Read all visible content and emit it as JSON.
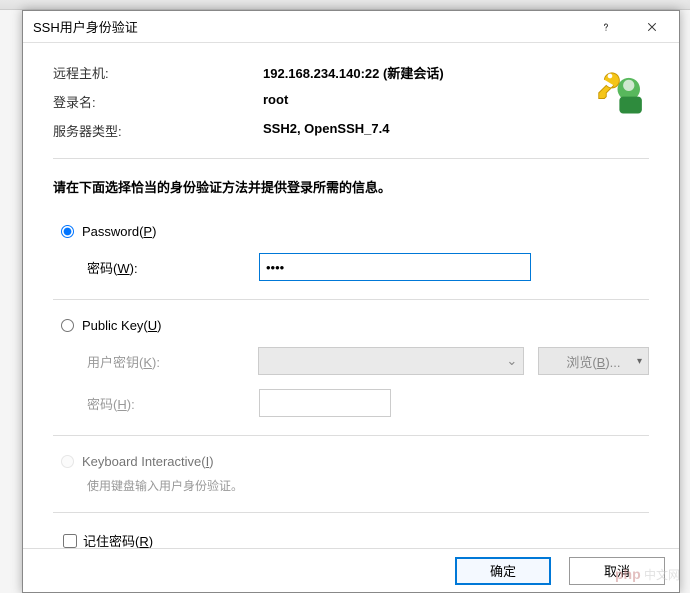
{
  "dialog": {
    "title": "SSH用户身份验证",
    "info": {
      "remote_host_label": "远程主机:",
      "remote_host_value": "192.168.234.140:22 (新建会话)",
      "login_label": "登录名:",
      "login_value": "root",
      "server_type_label": "服务器类型:",
      "server_type_value": "SSH2, OpenSSH_7.4"
    },
    "instruction": "请在下面选择恰当的身份验证方法并提供登录所需的信息。",
    "auth": {
      "password": {
        "radio_label_main": "Password(",
        "radio_label_accel": "P",
        "radio_label_end": ")",
        "pwd_label_main": "密码(",
        "pwd_label_accel": "W",
        "pwd_label_end": "):",
        "pwd_value": "••••",
        "selected": true
      },
      "publickey": {
        "radio_label_main": "Public Key(",
        "radio_label_accel": "U",
        "radio_label_end": ")",
        "key_label_main": "用户密钥(",
        "key_label_accel": "K",
        "key_label_end": "):",
        "browse_main": "浏览(",
        "browse_accel": "B",
        "browse_end": ")...",
        "pwd_label_main": "密码(",
        "pwd_label_accel": "H",
        "pwd_label_end": "):"
      },
      "keyboard": {
        "radio_label_main": "Keyboard Interactive(",
        "radio_label_accel": "I",
        "radio_label_end": ")",
        "helper": "使用键盘输入用户身份验证。"
      }
    },
    "remember_main": "记住密码(",
    "remember_accel": "R",
    "remember_end": ")",
    "buttons": {
      "ok": "确定",
      "cancel": "取消"
    }
  },
  "watermark": {
    "brand": "php",
    "text": "中文网"
  }
}
